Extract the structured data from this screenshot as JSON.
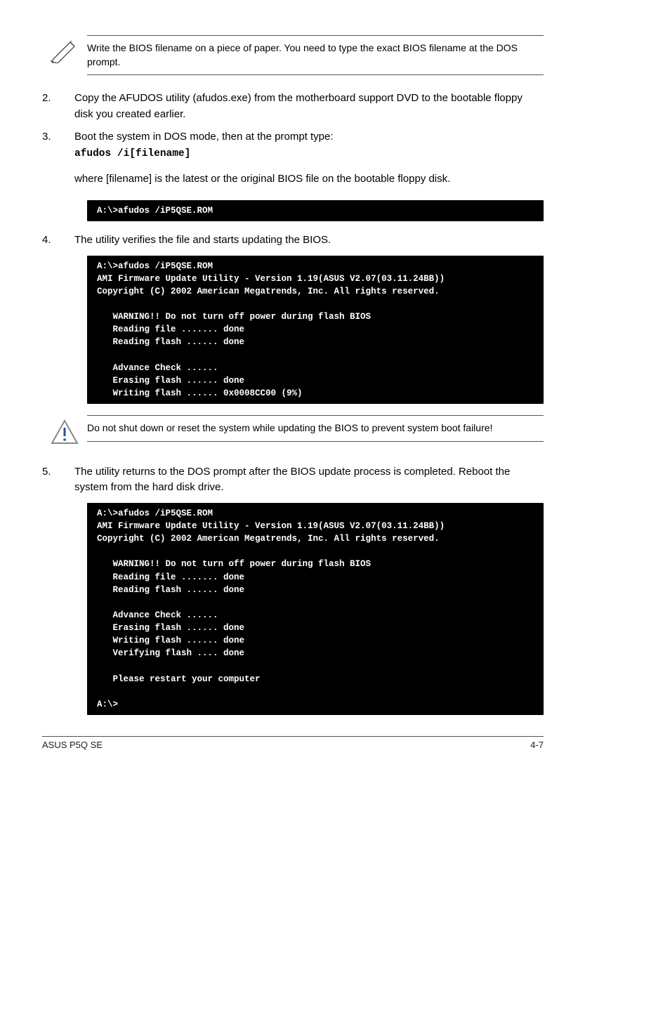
{
  "note1": "Write the BIOS filename on a piece of paper. You need to type the exact BIOS filename at the DOS prompt.",
  "step2": {
    "num": "2.",
    "text": "Copy the AFUDOS utility (afudos.exe) from the motherboard support DVD to the bootable floppy disk you created earlier."
  },
  "step3": {
    "num": "3.",
    "line1": "Boot the system in DOS mode, then at the prompt type:",
    "cmd": "afudos /i[filename]",
    "line2": "where [filename] is the latest or the original BIOS file on the bootable floppy disk."
  },
  "terminal1": "A:\\>afudos /iP5QSE.ROM",
  "step4": {
    "num": "4.",
    "text": "The utility verifies the file and starts updating the BIOS."
  },
  "terminal2": "A:\\>afudos /iP5QSE.ROM\nAMI Firmware Update Utility - Version 1.19(ASUS V2.07(03.11.24BB))\nCopyright (C) 2002 American Megatrends, Inc. All rights reserved.\n\n   WARNING!! Do not turn off power during flash BIOS\n   Reading file ....... done\n   Reading flash ...... done\n\n   Advance Check ......\n   Erasing flash ...... done\n   Writing flash ...... 0x0008CC00 (9%)",
  "warning1": "Do not shut down or reset the system while updating the BIOS to prevent system boot failure!",
  "step5": {
    "num": "5.",
    "text": "The utility returns to the DOS prompt after the BIOS update process is completed. Reboot the system from the hard disk drive."
  },
  "terminal3": "A:\\>afudos /iP5QSE.ROM\nAMI Firmware Update Utility - Version 1.19(ASUS V2.07(03.11.24BB))\nCopyright (C) 2002 American Megatrends, Inc. All rights reserved.\n\n   WARNING!! Do not turn off power during flash BIOS\n   Reading file ....... done\n   Reading flash ...... done\n\n   Advance Check ......\n   Erasing flash ...... done\n   Writing flash ...... done\n   Verifying flash .... done\n\n   Please restart your computer\n\nA:\\>",
  "footer": {
    "left": "ASUS P5Q SE",
    "right": "4-7"
  }
}
